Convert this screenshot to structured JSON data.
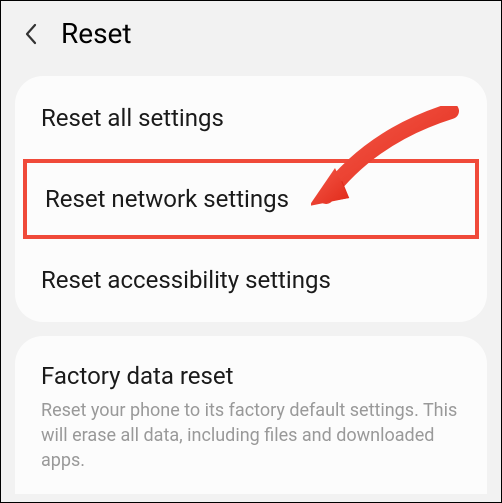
{
  "header": {
    "title": "Reset"
  },
  "items": [
    {
      "label": "Reset all settings"
    },
    {
      "label": "Reset network settings"
    },
    {
      "label": "Reset accessibility settings"
    }
  ],
  "factory": {
    "title": "Factory data reset",
    "description": "Reset your phone to its factory default settings. This will erase all data, including files and downloaded apps."
  },
  "annotation": {
    "highlight_color": "#f04a3a",
    "arrow_color": "#ed3b2e"
  }
}
